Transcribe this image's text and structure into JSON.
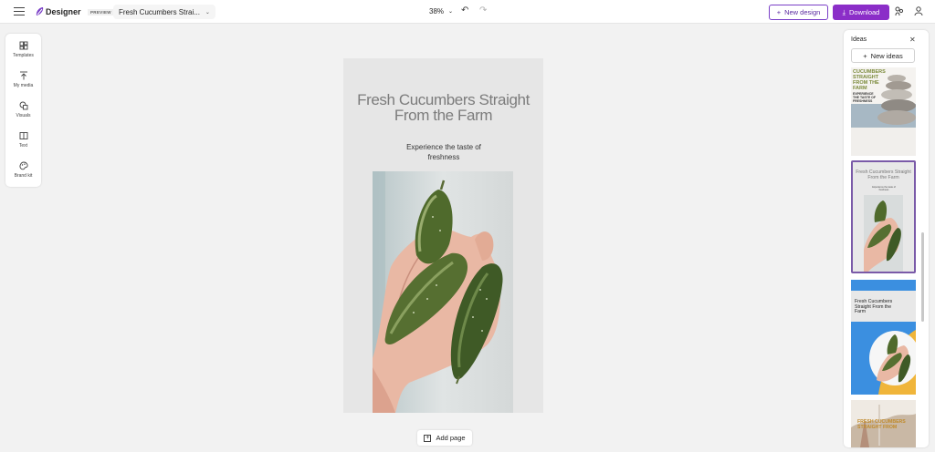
{
  "app": {
    "brand": "Designer",
    "badge": "PREVIEW",
    "doc_title": "Fresh Cucumbers Strai...",
    "zoom": "38%",
    "new_design": "New design",
    "download": "Download"
  },
  "tools": [
    {
      "label": "Templates",
      "icon": "templates-icon"
    },
    {
      "label": "My media",
      "icon": "upload-icon"
    },
    {
      "label": "Visuals",
      "icon": "shapes-icon"
    },
    {
      "label": "Text",
      "icon": "text-icon"
    },
    {
      "label": "Brand kit",
      "icon": "palette-icon"
    }
  ],
  "canvas": {
    "headline": "Fresh Cucumbers Straight From the Farm",
    "subline": "Experience the taste of freshness"
  },
  "add_page": "Add page",
  "ideas": {
    "title": "Ideas",
    "new_ideas": "New ideas",
    "thumbs": [
      {
        "text": "CUCUMBERS STRAIGHT FROM THE FARM",
        "sub": "EXPERIENCE THE TASTE OF FRESHNESS"
      },
      {
        "text": "Fresh Cucumbers Straight From the Farm",
        "sub": "Experience the taste of freshness"
      },
      {
        "text": "Fresh Cucumbers Straight From the Farm"
      },
      {
        "text": "FRESH CUCUMBERS STRAIGHT FROM"
      }
    ]
  },
  "colors": {
    "accent": "#8b2ec8",
    "accent_border": "#7a3fc7",
    "canvas_bg": "#e6e6e6",
    "app_bg": "#f2f2f2"
  }
}
